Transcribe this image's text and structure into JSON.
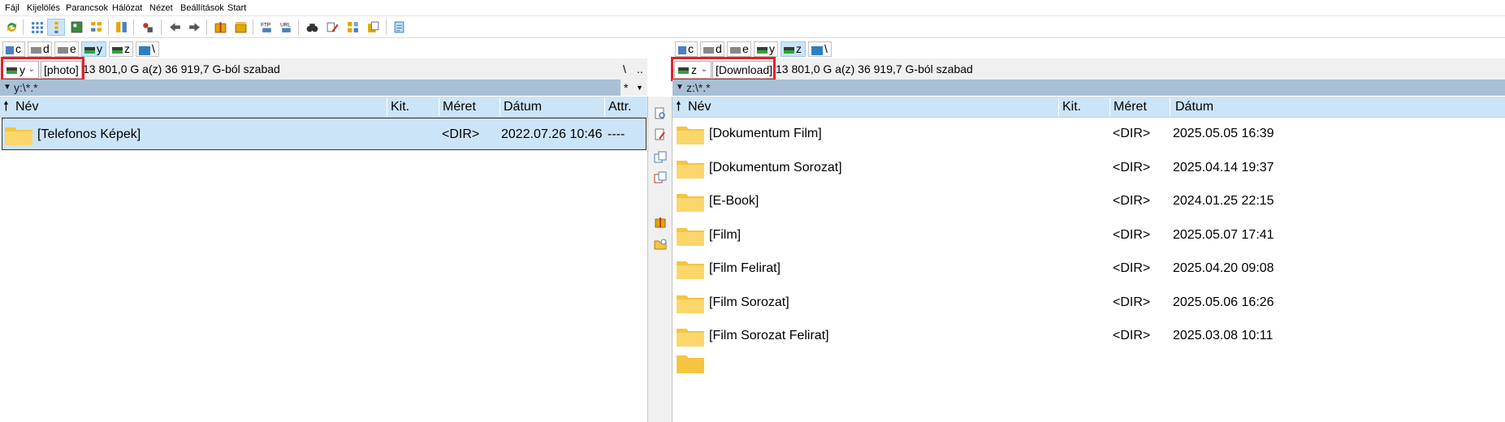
{
  "menu": [
    "Fájl",
    "Kijelölés",
    "Parancsok",
    "Hálózat",
    "Nézet",
    "Beállítások",
    "Start"
  ],
  "toolbar": {
    "icons": [
      "refresh-icon",
      "icons-view-icon",
      "list-view-icon",
      "thumbnail-view-icon",
      "tree-view-icon",
      "compare-dirs-icon",
      "sync-dirs-icon",
      "back-icon",
      "forward-icon",
      "pack-icon",
      "unpack-icon",
      "ftp-icon",
      "url-icon",
      "search-icon",
      "multi-rename-icon",
      "sync-icon",
      "copy-names-icon",
      "notepad-icon"
    ]
  },
  "left": {
    "drives": [
      "c",
      "d",
      "e",
      "y",
      "z",
      "\\"
    ],
    "active_drive": "y",
    "drive_combo": "y",
    "volume_label": "[photo]",
    "free_space": "13 801,0 G a(z) 36 919,7 G-ból szabad",
    "nav_root": "\\",
    "nav_up": "..",
    "filter_path": "y:\\*.*",
    "history": "*",
    "columns": {
      "name": "Név",
      "ext": "Kit.",
      "size": "Méret",
      "date": "Dátum",
      "attr": "Attr."
    },
    "rows": [
      {
        "name": "[Telefonos Képek]",
        "size": "<DIR>",
        "date": "2022.07.26 10:46",
        "attr": "----"
      }
    ]
  },
  "right": {
    "drives": [
      "c",
      "d",
      "e",
      "y",
      "z",
      "\\"
    ],
    "active_drive": "z",
    "drive_combo": "z",
    "volume_label": "[Download]",
    "free_space": "13 801,0 G a(z) 36 919,7 G-ból szabad",
    "filter_path": "z:\\*.*",
    "columns": {
      "name": "Név",
      "ext": "Kit.",
      "size": "Méret",
      "date": "Dátum"
    },
    "rows": [
      {
        "name": "[Dokumentum Film]",
        "size": "<DIR>",
        "date": "2025.05.05 16:39"
      },
      {
        "name": "[Dokumentum Sorozat]",
        "size": "<DIR>",
        "date": "2025.04.14 19:37"
      },
      {
        "name": "[E-Book]",
        "size": "<DIR>",
        "date": "2024.01.25 22:15"
      },
      {
        "name": "[Film]",
        "size": "<DIR>",
        "date": "2025.05.07 17:41"
      },
      {
        "name": "[Film Felirat]",
        "size": "<DIR>",
        "date": "2025.04.20 09:08"
      },
      {
        "name": "[Film Sorozat]",
        "size": "<DIR>",
        "date": "2025.05.06 16:26"
      },
      {
        "name": "[Film Sorozat Felirat]",
        "size": "<DIR>",
        "date": "2025.03.08 10:11"
      }
    ]
  }
}
